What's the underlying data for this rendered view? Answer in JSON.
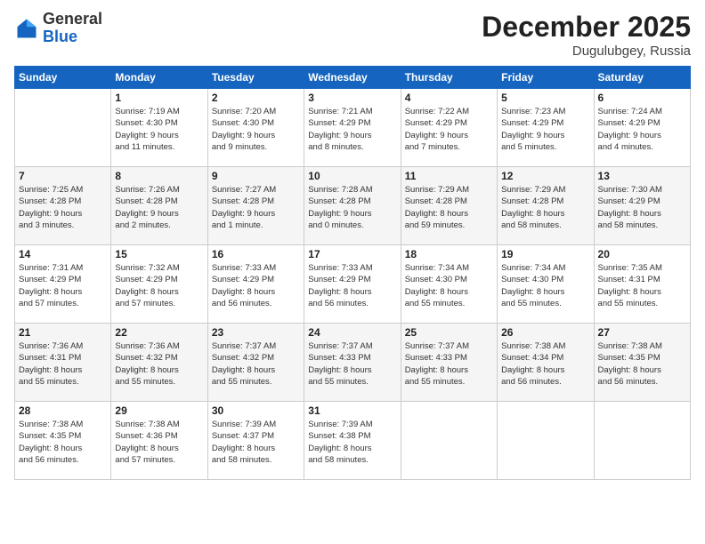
{
  "header": {
    "logo_general": "General",
    "logo_blue": "Blue",
    "month_title": "December 2025",
    "location": "Dugulubgey, Russia"
  },
  "days_of_week": [
    "Sunday",
    "Monday",
    "Tuesday",
    "Wednesday",
    "Thursday",
    "Friday",
    "Saturday"
  ],
  "weeks": [
    [
      {
        "day": "",
        "info": ""
      },
      {
        "day": "1",
        "info": "Sunrise: 7:19 AM\nSunset: 4:30 PM\nDaylight: 9 hours\nand 11 minutes."
      },
      {
        "day": "2",
        "info": "Sunrise: 7:20 AM\nSunset: 4:30 PM\nDaylight: 9 hours\nand 9 minutes."
      },
      {
        "day": "3",
        "info": "Sunrise: 7:21 AM\nSunset: 4:29 PM\nDaylight: 9 hours\nand 8 minutes."
      },
      {
        "day": "4",
        "info": "Sunrise: 7:22 AM\nSunset: 4:29 PM\nDaylight: 9 hours\nand 7 minutes."
      },
      {
        "day": "5",
        "info": "Sunrise: 7:23 AM\nSunset: 4:29 PM\nDaylight: 9 hours\nand 5 minutes."
      },
      {
        "day": "6",
        "info": "Sunrise: 7:24 AM\nSunset: 4:29 PM\nDaylight: 9 hours\nand 4 minutes."
      }
    ],
    [
      {
        "day": "7",
        "info": "Sunrise: 7:25 AM\nSunset: 4:28 PM\nDaylight: 9 hours\nand 3 minutes."
      },
      {
        "day": "8",
        "info": "Sunrise: 7:26 AM\nSunset: 4:28 PM\nDaylight: 9 hours\nand 2 minutes."
      },
      {
        "day": "9",
        "info": "Sunrise: 7:27 AM\nSunset: 4:28 PM\nDaylight: 9 hours\nand 1 minute."
      },
      {
        "day": "10",
        "info": "Sunrise: 7:28 AM\nSunset: 4:28 PM\nDaylight: 9 hours\nand 0 minutes."
      },
      {
        "day": "11",
        "info": "Sunrise: 7:29 AM\nSunset: 4:28 PM\nDaylight: 8 hours\nand 59 minutes."
      },
      {
        "day": "12",
        "info": "Sunrise: 7:29 AM\nSunset: 4:28 PM\nDaylight: 8 hours\nand 58 minutes."
      },
      {
        "day": "13",
        "info": "Sunrise: 7:30 AM\nSunset: 4:29 PM\nDaylight: 8 hours\nand 58 minutes."
      }
    ],
    [
      {
        "day": "14",
        "info": "Sunrise: 7:31 AM\nSunset: 4:29 PM\nDaylight: 8 hours\nand 57 minutes."
      },
      {
        "day": "15",
        "info": "Sunrise: 7:32 AM\nSunset: 4:29 PM\nDaylight: 8 hours\nand 57 minutes."
      },
      {
        "day": "16",
        "info": "Sunrise: 7:33 AM\nSunset: 4:29 PM\nDaylight: 8 hours\nand 56 minutes."
      },
      {
        "day": "17",
        "info": "Sunrise: 7:33 AM\nSunset: 4:29 PM\nDaylight: 8 hours\nand 56 minutes."
      },
      {
        "day": "18",
        "info": "Sunrise: 7:34 AM\nSunset: 4:30 PM\nDaylight: 8 hours\nand 55 minutes."
      },
      {
        "day": "19",
        "info": "Sunrise: 7:34 AM\nSunset: 4:30 PM\nDaylight: 8 hours\nand 55 minutes."
      },
      {
        "day": "20",
        "info": "Sunrise: 7:35 AM\nSunset: 4:31 PM\nDaylight: 8 hours\nand 55 minutes."
      }
    ],
    [
      {
        "day": "21",
        "info": "Sunrise: 7:36 AM\nSunset: 4:31 PM\nDaylight: 8 hours\nand 55 minutes."
      },
      {
        "day": "22",
        "info": "Sunrise: 7:36 AM\nSunset: 4:32 PM\nDaylight: 8 hours\nand 55 minutes."
      },
      {
        "day": "23",
        "info": "Sunrise: 7:37 AM\nSunset: 4:32 PM\nDaylight: 8 hours\nand 55 minutes."
      },
      {
        "day": "24",
        "info": "Sunrise: 7:37 AM\nSunset: 4:33 PM\nDaylight: 8 hours\nand 55 minutes."
      },
      {
        "day": "25",
        "info": "Sunrise: 7:37 AM\nSunset: 4:33 PM\nDaylight: 8 hours\nand 55 minutes."
      },
      {
        "day": "26",
        "info": "Sunrise: 7:38 AM\nSunset: 4:34 PM\nDaylight: 8 hours\nand 56 minutes."
      },
      {
        "day": "27",
        "info": "Sunrise: 7:38 AM\nSunset: 4:35 PM\nDaylight: 8 hours\nand 56 minutes."
      }
    ],
    [
      {
        "day": "28",
        "info": "Sunrise: 7:38 AM\nSunset: 4:35 PM\nDaylight: 8 hours\nand 56 minutes."
      },
      {
        "day": "29",
        "info": "Sunrise: 7:38 AM\nSunset: 4:36 PM\nDaylight: 8 hours\nand 57 minutes."
      },
      {
        "day": "30",
        "info": "Sunrise: 7:39 AM\nSunset: 4:37 PM\nDaylight: 8 hours\nand 58 minutes."
      },
      {
        "day": "31",
        "info": "Sunrise: 7:39 AM\nSunset: 4:38 PM\nDaylight: 8 hours\nand 58 minutes."
      },
      {
        "day": "",
        "info": ""
      },
      {
        "day": "",
        "info": ""
      },
      {
        "day": "",
        "info": ""
      }
    ]
  ]
}
